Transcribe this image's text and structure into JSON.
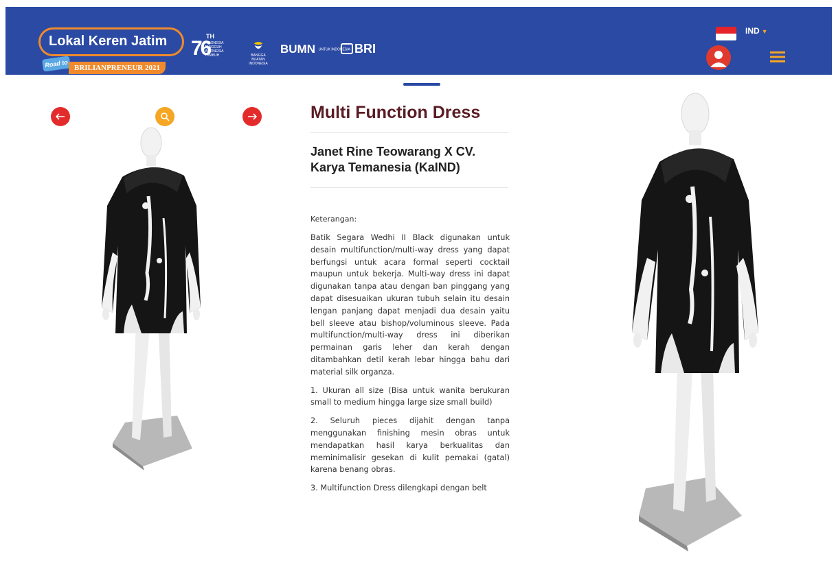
{
  "header": {
    "brand_name": "Lokal Keren Jatim",
    "brand_road": "Road to",
    "brand_sub": "BRILIANPRENEUR 2021",
    "logo_76": "76",
    "logo_76_sup": "TH",
    "logo_76_text": "INDONESIA TANGGUH INDONESIA TUMBUH",
    "logo_bangga_text": "BANGGA BUATAN INDONESIA",
    "logo_bumn": "BUMN",
    "logo_bumn_sub": "UNTUK INDONESIA",
    "logo_bri": "BRI",
    "language": "IND",
    "icons": [
      "indonesia-flag-icon",
      "user-avatar-icon",
      "hamburger-menu-icon"
    ]
  },
  "controls": {
    "prev_icon": "arrow-left-icon",
    "zoom_icon": "search-icon",
    "next_icon": "arrow-right-icon"
  },
  "product": {
    "title": "Multi Function Dress",
    "designer_line1": "Janet Rine Teowarang X CV.",
    "designer_line2": "Karya Temanesia (KaIND)",
    "description_label": "Keterangan:",
    "description": "Batik Segara Wedhi II Black digunakan untuk desain multifunction/multi-way dress yang dapat berfungsi untuk acara formal seperti cocktail maupun untuk bekerja. Multi-way dress ini dapat digunakan tanpa atau dengan ban pinggang yang dapat disesuaikan ukuran tubuh selain itu desain lengan panjang dapat menjadi dua desain yaitu bell sleeve atau bishop/voluminous sleeve. Pada multifunction/multi-way dress ini diberikan permainan garis leher dan kerah dengan ditambahkan detil kerah lebar hingga bahu dari material silk organza.",
    "point_1": "1. Ukuran all size (Bisa untuk wanita berukuran small to medium hingga large size small build)",
    "point_2": "2. Seluruh pieces dijahit dengan tanpa menggunakan finishing mesin obras untuk mendapatkan hasil karya berkualitas dan meminimalisir gesekan di kulit pemakai (gatal) karena benang obras.",
    "point_3": "3. Multifunction Dress dilengkapi dengan belt",
    "image_subject": "dress-on-mannequin"
  },
  "colors": {
    "header_bg": "#2b4aa4",
    "brand_orange": "#f08a2c",
    "accent_red": "#e42b2b",
    "accent_yellow": "#f5a623",
    "title_color": "#5a1c24"
  }
}
